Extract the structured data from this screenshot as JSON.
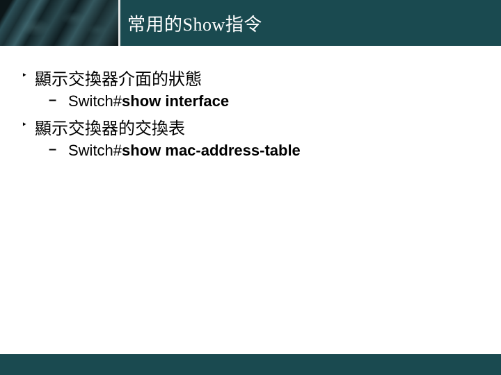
{
  "title": "常用的Show指令",
  "items": [
    {
      "heading": "顯示交換器介面的狀態",
      "sub_prefix": "Switch#",
      "sub_cmd": "show interface"
    },
    {
      "heading": "顯示交換器的交換表",
      "sub_prefix": "Switch#",
      "sub_cmd": "show mac-address-table"
    }
  ],
  "bullet_glyph": "‣",
  "dash_glyph": "–"
}
